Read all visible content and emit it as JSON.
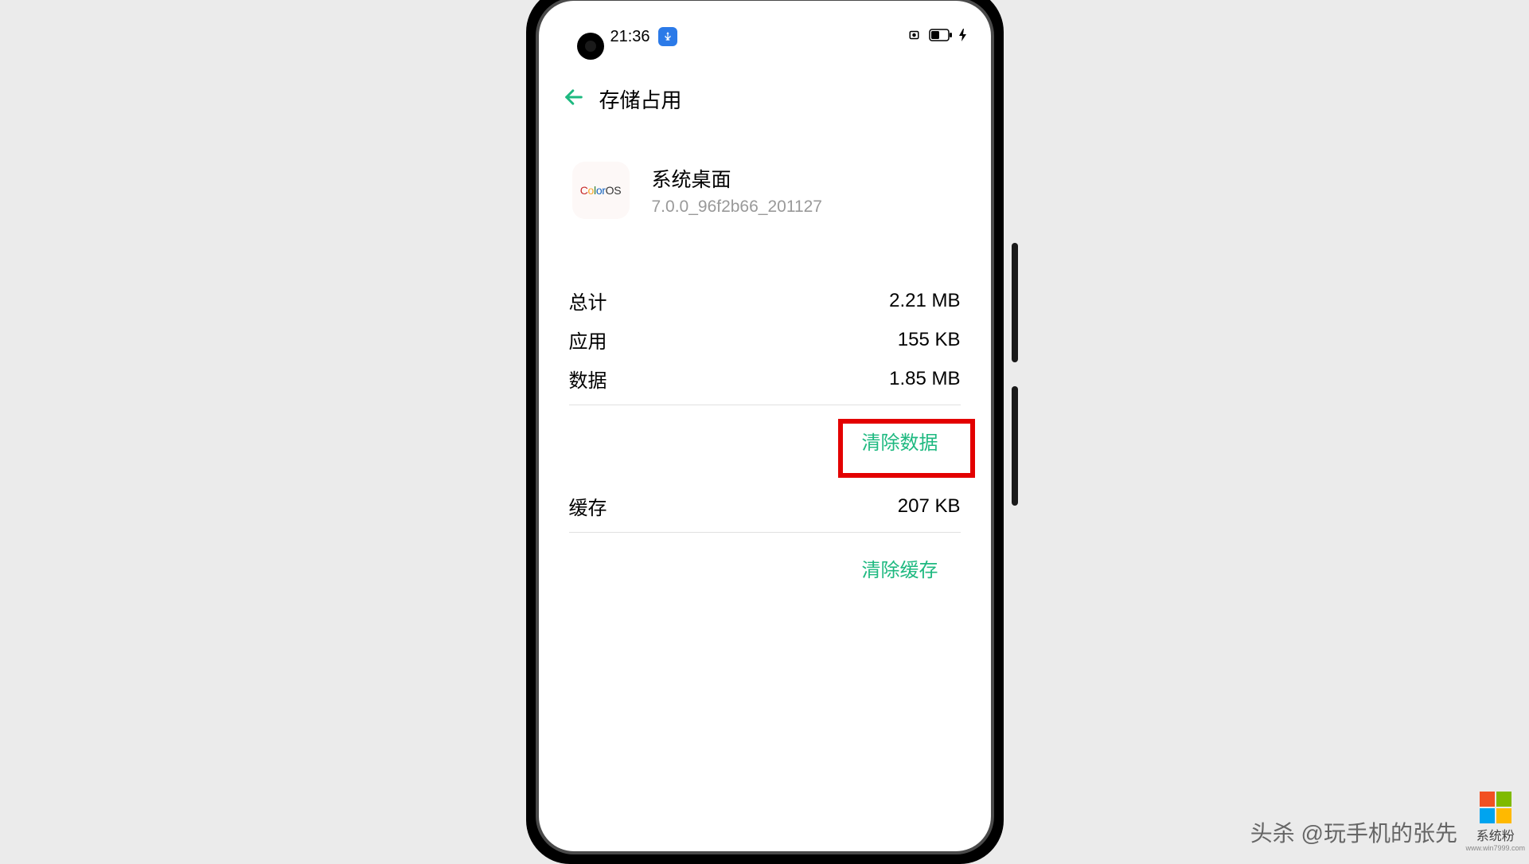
{
  "status_bar": {
    "time": "21:36"
  },
  "header": {
    "title": "存储占用"
  },
  "app": {
    "icon_text": "ColorOS",
    "name": "系统桌面",
    "version": "7.0.0_96f2b66_201127"
  },
  "storage": {
    "total_label": "总计",
    "total_value": "2.21 MB",
    "app_label": "应用",
    "app_value": "155 KB",
    "data_label": "数据",
    "data_value": "1.85 MB",
    "clear_data_label": "清除数据",
    "cache_label": "缓存",
    "cache_value": "207 KB",
    "clear_cache_label": "清除缓存"
  },
  "watermark": {
    "bottom_text": "头杀 @玩手机的张先",
    "brand": "系统粉",
    "url": "www.win7999.com"
  }
}
